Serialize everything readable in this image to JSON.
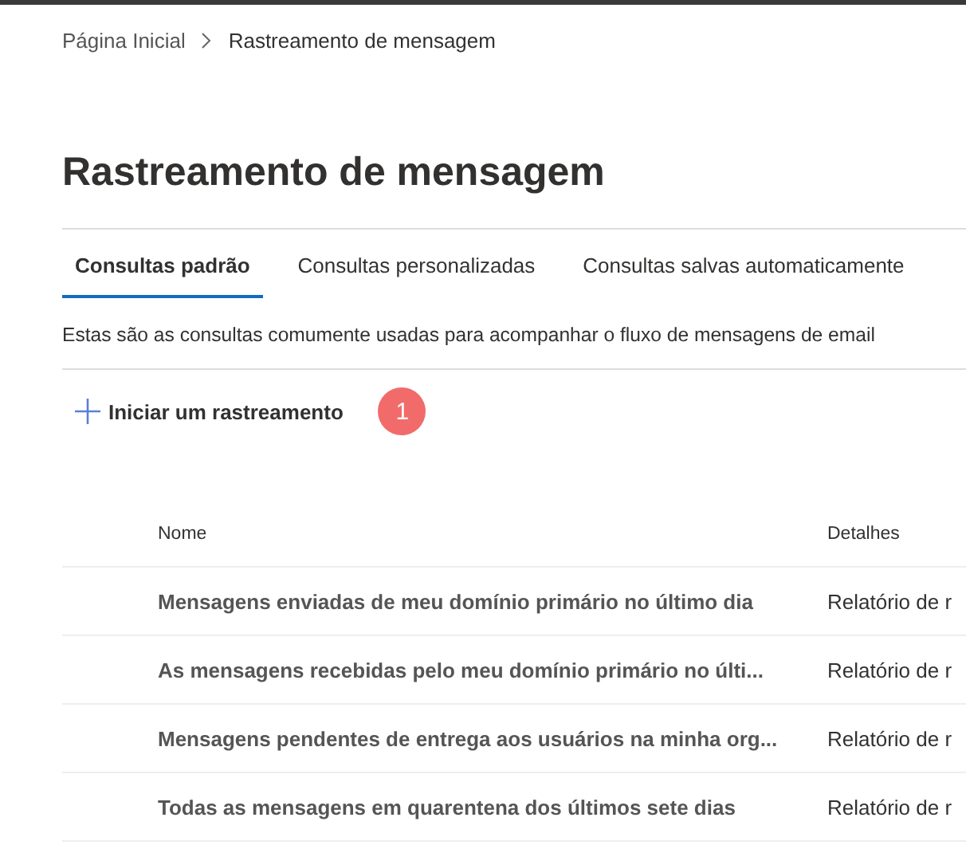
{
  "breadcrumb": [
    {
      "label": "Página Inicial",
      "current": false
    },
    {
      "label": "Rastreamento de mensagem",
      "current": true
    }
  ],
  "title": "Rastreamento de mensagem",
  "tabs": [
    {
      "label": "Consultas padrão",
      "selected": true
    },
    {
      "label": "Consultas personalizadas",
      "selected": false
    },
    {
      "label": "Consultas salvas automaticamente",
      "selected": false
    }
  ],
  "description": "Estas são as consultas comumente usadas para acompanhar o fluxo de mensagens de email",
  "start_button": {
    "label": "Iniciar um rastreamento",
    "badge": "1"
  },
  "table": {
    "columns": [
      "Nome",
      "Detalhes"
    ],
    "rows": [
      [
        "Mensagens enviadas de meu domínio primário no último dia",
        "Relatório de r"
      ],
      [
        "As mensagens recebidas pelo meu domínio primário no últi...",
        "Relatório de r"
      ],
      [
        "Mensagens pendentes de entrega aos usuários na minha org...",
        "Relatório de r"
      ],
      [
        "Todas as mensagens em quarentena dos últimos sete dias",
        "Relatório de r"
      ]
    ]
  }
}
